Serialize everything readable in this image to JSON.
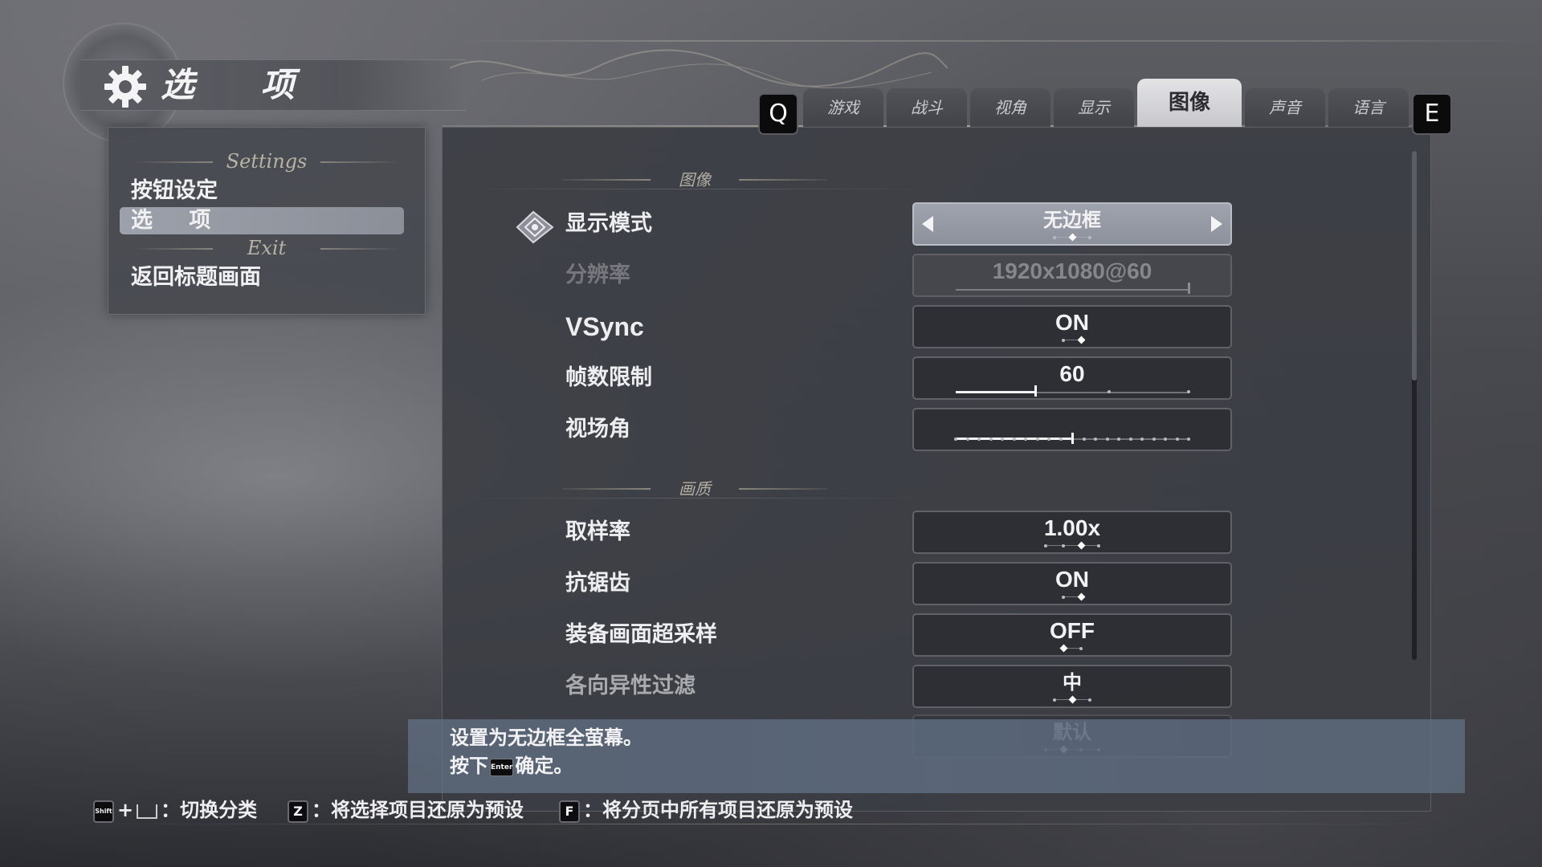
{
  "title": {
    "text": "选 项",
    "icon": "gear-icon"
  },
  "sidebar": {
    "sections": [
      {
        "heading": "Settings",
        "items": [
          {
            "label": "按钮设定"
          },
          {
            "label": "选 项",
            "selected": true
          }
        ]
      },
      {
        "heading": "Exit",
        "items": [
          {
            "label": "返回标题画面"
          }
        ]
      }
    ]
  },
  "tabs": {
    "prev_key": "Q",
    "next_key": "E",
    "items": [
      {
        "label": "游戏"
      },
      {
        "label": "战斗"
      },
      {
        "label": "视角"
      },
      {
        "label": "显示"
      },
      {
        "label": "图像",
        "active": true
      },
      {
        "label": "声音"
      },
      {
        "label": "语言"
      }
    ]
  },
  "groups": {
    "image": "图像",
    "quality": "画质"
  },
  "options": [
    {
      "label": "显示模式",
      "value": "无边框",
      "type": "selector",
      "selected": true,
      "option_count": 3,
      "option_index": 1
    },
    {
      "label": "分辨率",
      "value": "1920x1080@60",
      "type": "slider-disabled",
      "enabled": false
    },
    {
      "label": "VSync",
      "value": "ON",
      "type": "toggle",
      "option_count": 2,
      "option_index": 1
    },
    {
      "label": "帧数限制",
      "value": "60",
      "type": "slider",
      "fraction": 0.34
    },
    {
      "label": "视场角",
      "value": "",
      "type": "steps",
      "step_count": 21,
      "step_index": 10
    },
    {
      "label": "取样率",
      "value": "1.00x",
      "type": "toggle",
      "option_count": 4,
      "option_index": 2
    },
    {
      "label": "抗锯齿",
      "value": "ON",
      "type": "toggle",
      "option_count": 2,
      "option_index": 1
    },
    {
      "label": "装备画面超采样",
      "value": "OFF",
      "type": "toggle",
      "option_count": 2,
      "option_index": 0
    },
    {
      "label": "各向异性过滤",
      "value": "中",
      "type": "toggle",
      "option_count": 3,
      "option_index": 1,
      "dim": true
    },
    {
      "label": "",
      "value": "默认",
      "type": "toggle",
      "option_count": 4,
      "option_index": 1,
      "faded": true
    }
  ],
  "description": {
    "line1": "设置为无边框全萤幕。",
    "line2_prefix": "按下",
    "line2_key": "Enter",
    "line2_suffix": "确定。"
  },
  "footer": {
    "hint1_key": "Shift",
    "hint1_plus": "+",
    "hint1_text": "：切换分类",
    "hint2_key": "Z",
    "hint2_text": "：将选择项目还原为预设",
    "hint3_key": "F",
    "hint3_text": "：将分页中所有项目还原为预设"
  },
  "colors": {
    "accent_tab": "#d6d6da",
    "highlight_row": "#9599a3",
    "description_bar": "#64738a",
    "ornament": "#b3aea2"
  }
}
